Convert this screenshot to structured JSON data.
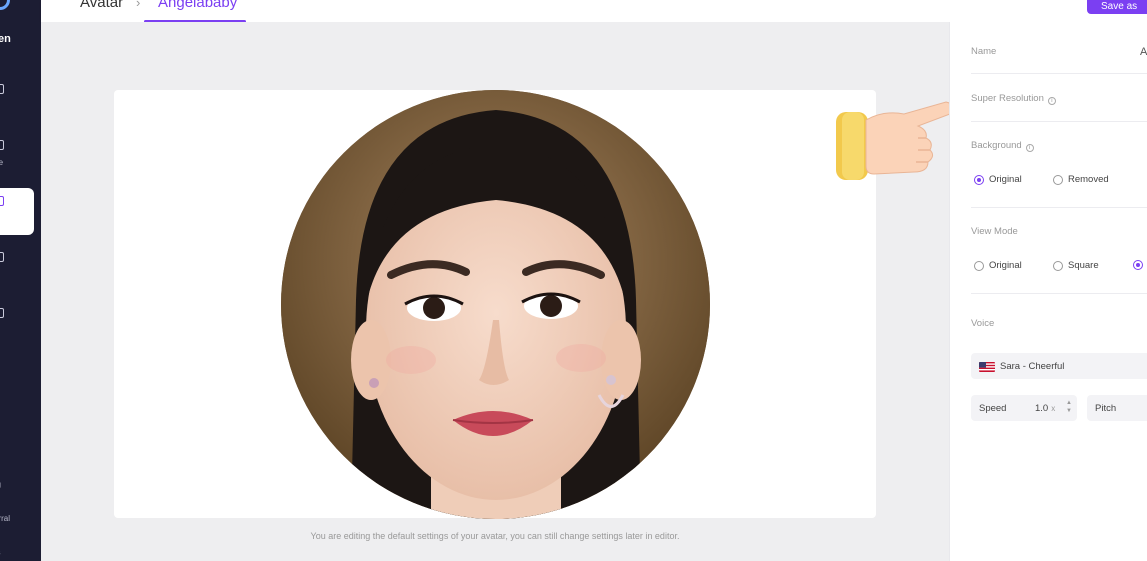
{
  "sidebar": {
    "brand": "en",
    "items": [
      {
        "label": "e",
        "icon": "home-icon"
      },
      {
        "label": "ate",
        "icon": "template-icon"
      },
      {
        "label": "ar",
        "icon": "avatar-icon",
        "active": true
      },
      {
        "label": "o",
        "icon": "video-icon"
      },
      {
        "label": "t",
        "icon": "asset-icon"
      }
    ],
    "bottom": [
      "ng",
      "erral",
      "es"
    ]
  },
  "header": {
    "breadcrumb_root": "Avatar",
    "breadcrumb_sep": "›",
    "breadcrumb_current": "Angelababy",
    "save_label": "Save as"
  },
  "main": {
    "caption": "You are editing the default settings of your avatar, you can still change settings later in editor."
  },
  "panel": {
    "name_label": "Name",
    "name_value": "A",
    "super_resolution_label": "Super Resolution",
    "background_label": "Background",
    "background_options": [
      {
        "label": "Original",
        "selected": true
      },
      {
        "label": "Removed",
        "selected": false
      }
    ],
    "view_mode_label": "View Mode",
    "view_mode_options": [
      {
        "label": "Original",
        "selected": false
      },
      {
        "label": "Square",
        "selected": false
      },
      {
        "label": "",
        "selected": true
      }
    ],
    "voice_label": "Voice",
    "voice_value": "Sara - Cheerful",
    "voice_flag": "us-flag-icon",
    "speed_label": "Speed",
    "speed_value": "1.0",
    "speed_unit": "x",
    "pitch_label": "Pitch"
  },
  "colors": {
    "accent": "#7b3ff2",
    "sidebar_bg": "#1c1d33"
  }
}
